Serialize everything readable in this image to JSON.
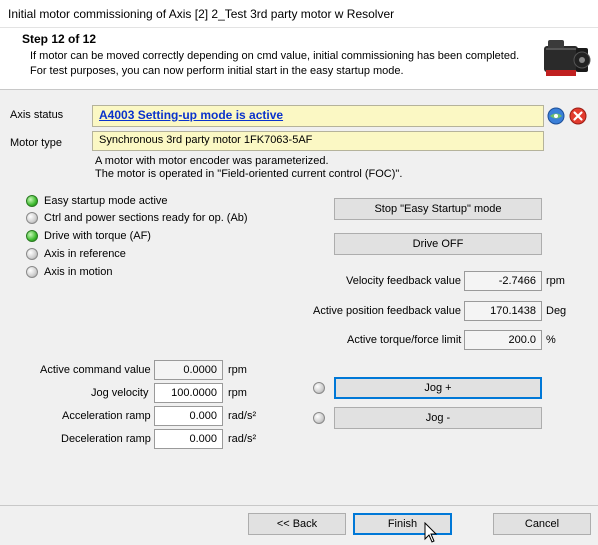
{
  "window": {
    "title": "Initial motor commissioning of Axis [2] 2_Test 3rd party motor w Resolver"
  },
  "header": {
    "step": "Step 12 of 12",
    "line1": "If motor can be moved correctly depending on cmd value, initial commissioning has been completed.",
    "line2": "For test purposes, you can now perform initial start in the easy startup mode."
  },
  "axis_status": {
    "label": "Axis status",
    "value": "A4003 Setting-up mode is active"
  },
  "motor_type": {
    "label": "Motor type",
    "value": "Synchronous 3rd party motor 1FK7063-5AF",
    "note1": "A motor with motor encoder was parameterized.",
    "note2": "The motor is operated in \"Field-oriented current control (FOC)\"."
  },
  "status_items": [
    {
      "label": "Easy startup mode active",
      "state": "on"
    },
    {
      "label": "Ctrl and power sections ready for op. (Ab)",
      "state": "off"
    },
    {
      "label": "Drive with torque (AF)",
      "state": "on"
    },
    {
      "label": "Axis in reference",
      "state": "off"
    },
    {
      "label": "Axis in motion",
      "state": "off"
    }
  ],
  "buttons": {
    "stop_easy": "Stop \"Easy Startup\" mode",
    "drive_off": "Drive OFF",
    "jog_plus": "Jog +",
    "jog_minus": "Jog -",
    "back": "<< Back",
    "finish": "Finish",
    "cancel": "Cancel"
  },
  "feedback": {
    "velocity": {
      "label": "Velocity feedback value",
      "value": "-2.7466",
      "unit": "rpm"
    },
    "position": {
      "label": "Active position feedback value",
      "value": "170.1438",
      "unit": "Deg"
    },
    "torque": {
      "label": "Active torque/force limit",
      "value": "200.0",
      "unit": "%"
    }
  },
  "jog": {
    "command": {
      "label": "Active command value",
      "value": "0.0000",
      "unit": "rpm"
    },
    "velocity": {
      "label": "Jog velocity",
      "value": "100.0000",
      "unit": "rpm"
    },
    "accel": {
      "label": "Acceleration ramp",
      "value": "0.000",
      "unit": "rad/s²"
    },
    "decel": {
      "label": "Deceleration ramp",
      "value": "0.000",
      "unit": "rad/s²"
    }
  },
  "colors": {
    "status_field_bg": "#fbf8c4",
    "link": "#0a33cc",
    "led_on": "#3dba2e",
    "focus": "#0078d7"
  },
  "icons": [
    "motor-image",
    "web-icon",
    "error-cross-icon",
    "mouse-cursor-icon"
  ]
}
